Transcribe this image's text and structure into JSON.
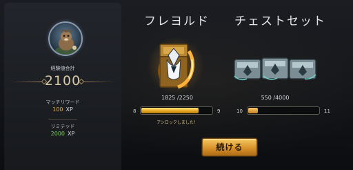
{
  "summary": {
    "total_label": "経験値合計",
    "total_value": "2100",
    "match_reward_label": "マッチリワード",
    "match_reward_value": "100",
    "match_reward_unit": "XP",
    "limited_label": "リミテッド",
    "limited_value": "2000",
    "limited_unit": "XP"
  },
  "fre_hold": {
    "title": "フレヨルド",
    "progress_text": "1825 /2250",
    "progress": 0.811,
    "level_start": "8",
    "level_end": "9",
    "unlock_note": "アンロックしました！"
  },
  "chest_set": {
    "title": "チェストセット",
    "progress_text": "550 /4000",
    "progress": 0.1375,
    "level_start": "10",
    "level_end": "11"
  },
  "actions": {
    "continue_label": "続ける"
  },
  "colors": {
    "accent_gold": "#e2b04a",
    "accent_green": "#79d35a",
    "button_gold": "#d8932a"
  }
}
